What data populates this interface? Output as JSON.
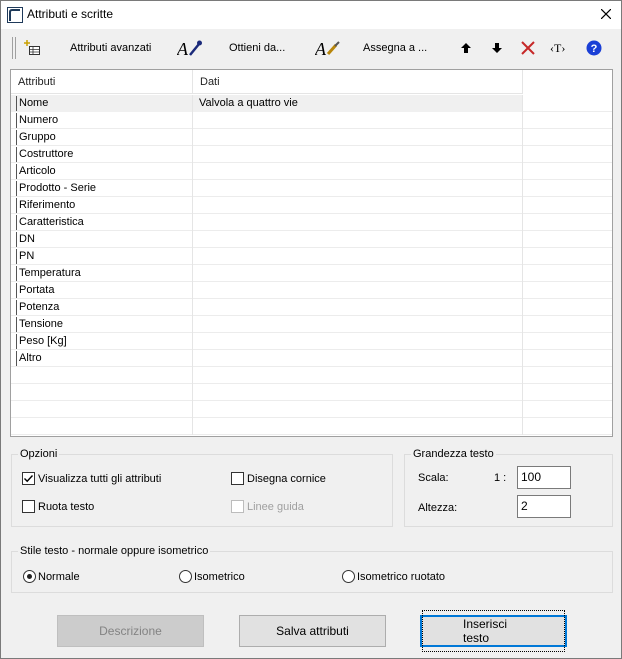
{
  "window": {
    "title": "Attributi e scritte",
    "close_glyph": "✕"
  },
  "toolbar": {
    "advanced_label": "Attributi avanzati",
    "get_from_label": "Ottieni da...",
    "assign_to_label": "Assegna a ...",
    "text_tag_glyph": "‹T›"
  },
  "grid": {
    "columns": [
      "Attributi",
      "Dati"
    ],
    "rows": [
      {
        "attr": "Nome",
        "data": "Valvola a quattro vie"
      },
      {
        "attr": "Numero",
        "data": ""
      },
      {
        "attr": "Gruppo",
        "data": ""
      },
      {
        "attr": "Costruttore",
        "data": ""
      },
      {
        "attr": "Articolo",
        "data": ""
      },
      {
        "attr": "Prodotto - Serie",
        "data": ""
      },
      {
        "attr": "Riferimento",
        "data": ""
      },
      {
        "attr": "Caratteristica",
        "data": ""
      },
      {
        "attr": "DN",
        "data": ""
      },
      {
        "attr": "PN",
        "data": ""
      },
      {
        "attr": "Temperatura",
        "data": ""
      },
      {
        "attr": "Portata",
        "data": ""
      },
      {
        "attr": "Potenza",
        "data": ""
      },
      {
        "attr": "Tensione",
        "data": ""
      },
      {
        "attr": "Peso [Kg]",
        "data": ""
      },
      {
        "attr": "Altro",
        "data": ""
      }
    ]
  },
  "options": {
    "title": "Opzioni",
    "show_all": {
      "label": "Visualizza tutti gli attributi",
      "checked": true
    },
    "draw_frame": {
      "label": "Disegna cornice",
      "checked": false
    },
    "rotate_text": {
      "label": "Ruota testo",
      "checked": false
    },
    "guide_lines": {
      "label": "Linee guida",
      "checked": false,
      "disabled": true
    }
  },
  "text_size": {
    "title": "Grandezza testo",
    "scale_label": "Scala:",
    "scale_prefix": "1 :",
    "scale_value": "100",
    "height_label": "Altezza:",
    "height_value": "2"
  },
  "style": {
    "title": "Stile testo - normale oppure isometrico",
    "options": [
      {
        "label": "Normale",
        "selected": true
      },
      {
        "label": "Isometrico",
        "selected": false
      },
      {
        "label": "Isometrico ruotato",
        "selected": false
      }
    ]
  },
  "buttons": {
    "description": "Descrizione",
    "save": "Salva attributi",
    "insert": "Inserisci testo"
  },
  "colors": {
    "accent": "#0078d7",
    "help_icon": "#1a3fd6",
    "delete_icon": "#c62828"
  }
}
